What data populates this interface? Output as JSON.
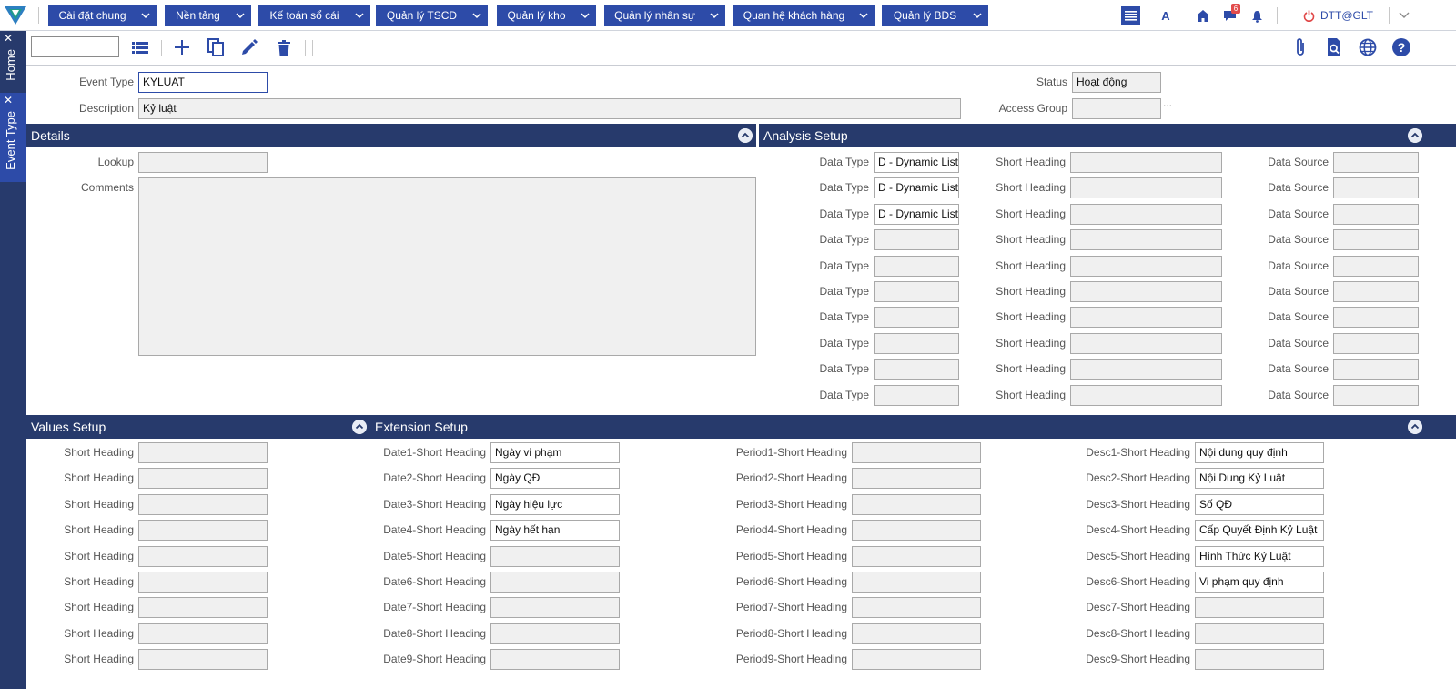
{
  "top_menu": [
    "Cài đặt chung",
    "Nền tảng",
    "Kế toán sổ cái",
    "Quản lý TSCĐ",
    "Quản lý kho",
    "Quản lý nhân sự",
    "Quan hệ khách hàng",
    "Quản lý BĐS"
  ],
  "topbar": {
    "font_label": "A",
    "notification_count": "6",
    "user": "DTT@GLT"
  },
  "left_tabs": {
    "home": "Home",
    "event_type": "Event Type"
  },
  "header_form": {
    "event_type_label": "Event Type",
    "event_type_value": "KYLUAT",
    "description_label": "Description",
    "description_value": "Kỷ luật",
    "status_label": "Status",
    "status_value": "Hoạt động",
    "access_group_label": "Access Group",
    "access_group_value": "",
    "access_group_more": "..."
  },
  "details": {
    "title": "Details",
    "lookup_label": "Lookup",
    "lookup_value": "",
    "comments_label": "Comments",
    "comments_value": ""
  },
  "analysis_setup": {
    "title": "Analysis Setup",
    "data_type_label": "Data Type",
    "short_heading_label": "Short Heading",
    "data_source_label": "Data Source",
    "rows": [
      {
        "data_type": "D - Dynamic List",
        "short_heading": "",
        "data_source": ""
      },
      {
        "data_type": "D - Dynamic List",
        "short_heading": "",
        "data_source": ""
      },
      {
        "data_type": "D - Dynamic List",
        "short_heading": "",
        "data_source": ""
      },
      {
        "data_type": "",
        "short_heading": "",
        "data_source": ""
      },
      {
        "data_type": "",
        "short_heading": "",
        "data_source": ""
      },
      {
        "data_type": "",
        "short_heading": "",
        "data_source": ""
      },
      {
        "data_type": "",
        "short_heading": "",
        "data_source": ""
      },
      {
        "data_type": "",
        "short_heading": "",
        "data_source": ""
      },
      {
        "data_type": "",
        "short_heading": "",
        "data_source": ""
      },
      {
        "data_type": "",
        "short_heading": "",
        "data_source": ""
      }
    ]
  },
  "values_setup": {
    "title": "Values Setup",
    "short_heading_label": "Short Heading",
    "values": [
      "",
      "",
      "",
      "",
      "",
      "",
      "",
      "",
      ""
    ]
  },
  "extension_setup": {
    "title": "Extension Setup",
    "date_labels": [
      "Date1-Short Heading",
      "Date2-Short Heading",
      "Date3-Short Heading",
      "Date4-Short Heading",
      "Date5-Short Heading",
      "Date6-Short Heading",
      "Date7-Short Heading",
      "Date8-Short Heading",
      "Date9-Short Heading"
    ],
    "date_values": [
      "Ngày vi phạm",
      "Ngày QĐ",
      "Ngày hiệu lực",
      "Ngày hết hạn",
      "",
      "",
      "",
      "",
      ""
    ],
    "period_labels": [
      "Period1-Short Heading",
      "Period2-Short Heading",
      "Period3-Short Heading",
      "Period4-Short Heading",
      "Period5-Short Heading",
      "Period6-Short Heading",
      "Period7-Short Heading",
      "Period8-Short Heading",
      "Period9-Short Heading"
    ],
    "period_values": [
      "",
      "",
      "",
      "",
      "",
      "",
      "",
      "",
      ""
    ],
    "desc_labels": [
      "Desc1-Short Heading",
      "Desc2-Short Heading",
      "Desc3-Short Heading",
      "Desc4-Short Heading",
      "Desc5-Short Heading",
      "Desc6-Short Heading",
      "Desc7-Short Heading",
      "Desc8-Short Heading",
      "Desc9-Short Heading"
    ],
    "desc_values": [
      "Nội dung quy định",
      "Nội Dung Kỷ Luật",
      "Số QĐ",
      "Cấp Quyết Định Kỷ Luật",
      "Hình Thức Kỷ Luật",
      "Vi phạm quy định",
      "",
      "",
      ""
    ]
  },
  "colors": {
    "menu_blue": "#2d4ba8",
    "section_navy": "#273a6c",
    "field_gray": "#f0f0f0"
  },
  "icons": [
    "logo-icon",
    "chevron-down-icon",
    "menu-lines-icon",
    "home-icon",
    "chat-icon",
    "bell-icon",
    "power-icon",
    "list-icon",
    "add-icon",
    "copy-icon",
    "edit-icon",
    "delete-icon",
    "attachment-icon",
    "search-doc-icon",
    "globe-icon",
    "help-icon",
    "close-icon",
    "collapse-icon"
  ]
}
